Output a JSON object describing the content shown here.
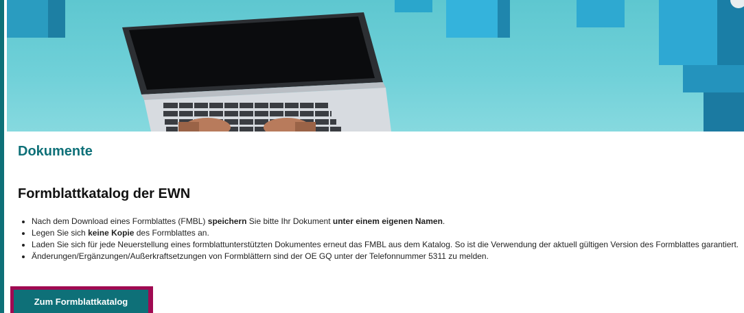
{
  "hero": {
    "image": "laptop-typing-illustration"
  },
  "main": {
    "section_title": "Dokumente",
    "page_title": "Formblattkatalog der EWN",
    "bullets": [
      {
        "parts": [
          {
            "text": "Nach dem Download eines Formblattes (FMBL) ",
            "bold": false
          },
          {
            "text": "speichern",
            "bold": true
          },
          {
            "text": " Sie bitte Ihr Dokument ",
            "bold": false
          },
          {
            "text": "unter einem eigenen Namen",
            "bold": true
          },
          {
            "text": ".",
            "bold": false
          }
        ]
      },
      {
        "parts": [
          {
            "text": "Legen Sie sich ",
            "bold": false
          },
          {
            "text": "keine Kopie",
            "bold": true
          },
          {
            "text": " des Formblattes an.",
            "bold": false
          }
        ]
      },
      {
        "parts": [
          {
            "text": "Laden Sie sich für jede Neuerstellung eines formblattunterstützten Dokumentes erneut das FMBL aus dem Katalog. So ist die Verwendung der aktuell gültigen Version des Formblattes garantiert.",
            "bold": false
          }
        ]
      },
      {
        "parts": [
          {
            "text": "Änderungen/Ergänzungen/Außerkraftsetzungen von Formblättern sind der OE GQ unter der Telefonnummer 5311 zu melden.",
            "bold": false
          }
        ]
      }
    ],
    "cta_label": "Zum Formblattkatalog"
  },
  "colors": {
    "accent": "#0e7078",
    "highlight_frame": "#a00a52",
    "hero_bg": "#6fd0d8"
  }
}
